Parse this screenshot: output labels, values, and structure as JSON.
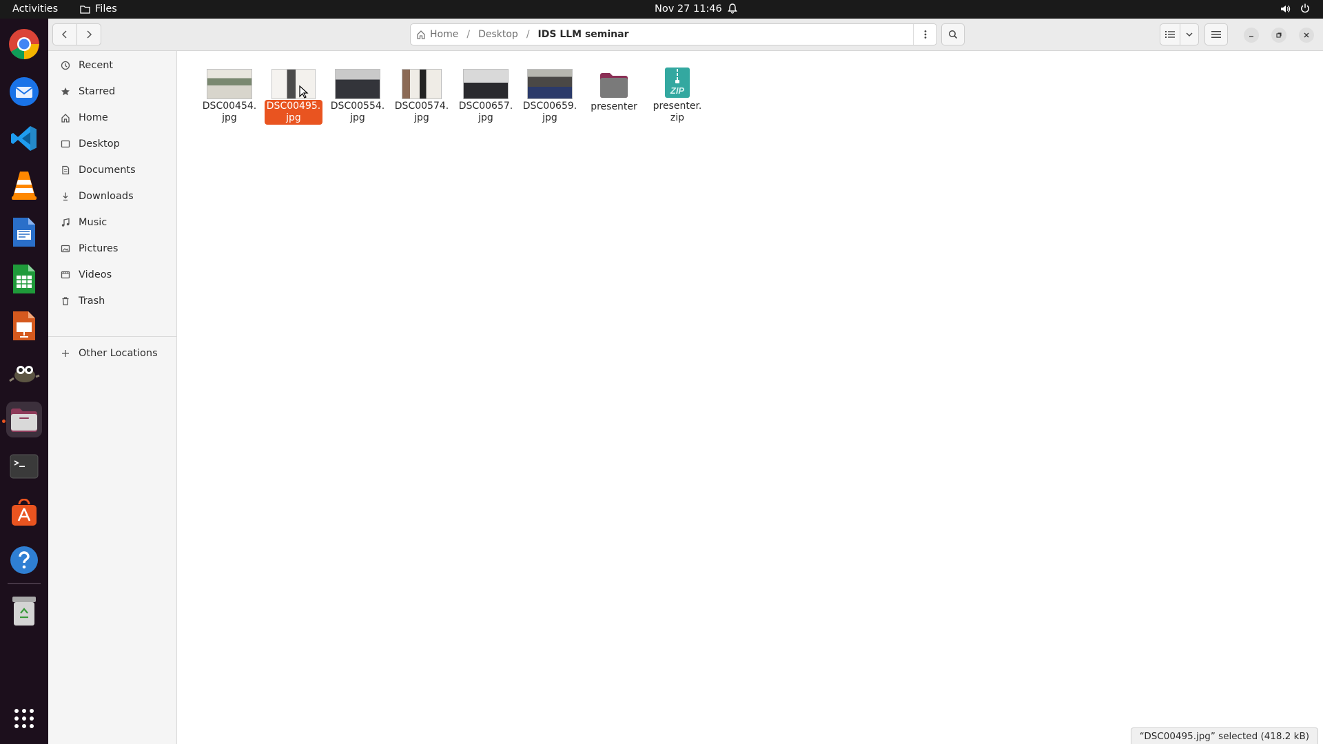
{
  "topbar": {
    "activities": "Activities",
    "app_name": "Files",
    "clock": "Nov 27  11:46"
  },
  "dock": {
    "items": [
      {
        "name": "chrome-icon"
      },
      {
        "name": "thunderbird-icon"
      },
      {
        "name": "vscode-icon"
      },
      {
        "name": "vlc-icon"
      },
      {
        "name": "writer-icon"
      },
      {
        "name": "calc-icon"
      },
      {
        "name": "impress-icon"
      },
      {
        "name": "gimp-icon"
      },
      {
        "name": "files-icon"
      },
      {
        "name": "terminal-icon"
      },
      {
        "name": "software-icon"
      },
      {
        "name": "help-icon"
      },
      {
        "name": "trash-icon"
      },
      {
        "name": "app-grid-icon"
      }
    ]
  },
  "pathbar": {
    "home": "Home",
    "desktop": "Desktop",
    "current": "IDS LLM seminar"
  },
  "sidebar": {
    "items": [
      {
        "label": "Recent",
        "icon": "clock-icon"
      },
      {
        "label": "Starred",
        "icon": "star-icon"
      },
      {
        "label": "Home",
        "icon": "home-icon"
      },
      {
        "label": "Desktop",
        "icon": "desktop-icon"
      },
      {
        "label": "Documents",
        "icon": "document-icon"
      },
      {
        "label": "Downloads",
        "icon": "download-icon"
      },
      {
        "label": "Music",
        "icon": "music-icon"
      },
      {
        "label": "Pictures",
        "icon": "picture-icon"
      },
      {
        "label": "Videos",
        "icon": "video-icon"
      },
      {
        "label": "Trash",
        "icon": "trash-icon"
      }
    ],
    "other_locations": "Other Locations"
  },
  "files": [
    {
      "line1": "DSC00454.",
      "line2": "jpg",
      "type": "image"
    },
    {
      "line1": "DSC00495.",
      "line2": "jpg",
      "type": "image",
      "selected": true
    },
    {
      "line1": "DSC00554.",
      "line2": "jpg",
      "type": "image"
    },
    {
      "line1": "DSC00574.",
      "line2": "jpg",
      "type": "image"
    },
    {
      "line1": "DSC00657.",
      "line2": "jpg",
      "type": "image"
    },
    {
      "line1": "DSC00659.",
      "line2": "jpg",
      "type": "image"
    },
    {
      "line1": "presenter",
      "line2": "",
      "type": "folder"
    },
    {
      "line1": "presenter.",
      "line2": "zip",
      "type": "zip"
    }
  ],
  "zip_label": "ZIP",
  "status": "“DSC00495.jpg” selected  (418.2 kB)",
  "colors": {
    "accent": "#e95420",
    "dock_bg": "#1c0f1c",
    "topbar_bg": "#1a1a1a"
  }
}
